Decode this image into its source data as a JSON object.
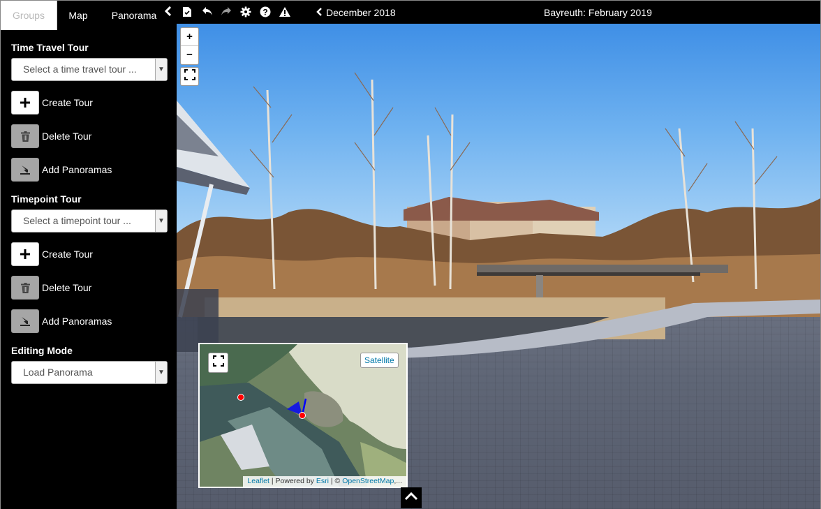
{
  "tabs": [
    {
      "label": "Groups",
      "active": true
    },
    {
      "label": "Map",
      "active": false
    },
    {
      "label": "Panorama",
      "active": false
    }
  ],
  "toolbar": {
    "icons": [
      "chevron-left-icon",
      "save-file-icon",
      "undo-icon",
      "redo-icon",
      "settings-icon",
      "help-icon",
      "warning-icon"
    ],
    "date_nav_label": "December 2018",
    "title": "Bayreuth: February 2019"
  },
  "sidebar": {
    "time_travel": {
      "title": "Time Travel Tour",
      "select_placeholder": "Select a time travel tour ...",
      "create_label": "Create Tour",
      "delete_label": "Delete Tour",
      "add_label": "Add Panoramas"
    },
    "timepoint": {
      "title": "Timepoint Tour",
      "select_placeholder": "Select a timepoint tour ...",
      "create_label": "Create Tour",
      "delete_label": "Delete Tour",
      "add_label": "Add Panoramas"
    },
    "editing": {
      "title": "Editing Mode",
      "selected": "Load Panorama"
    }
  },
  "viewer": {
    "zoom_in": "+",
    "zoom_out": "−"
  },
  "minimap": {
    "layer_button": "Satellite",
    "attribution": {
      "leaflet": "Leaflet",
      "powered": "| Powered by",
      "esri": "Esri",
      "sep": "| ©",
      "osm": "OpenStreetMap",
      "ellipsis": ",..."
    }
  },
  "colors": {
    "background": "#000000",
    "link": "#0078a8",
    "marker": "#ff0000",
    "view_cone": "#0000ff"
  }
}
